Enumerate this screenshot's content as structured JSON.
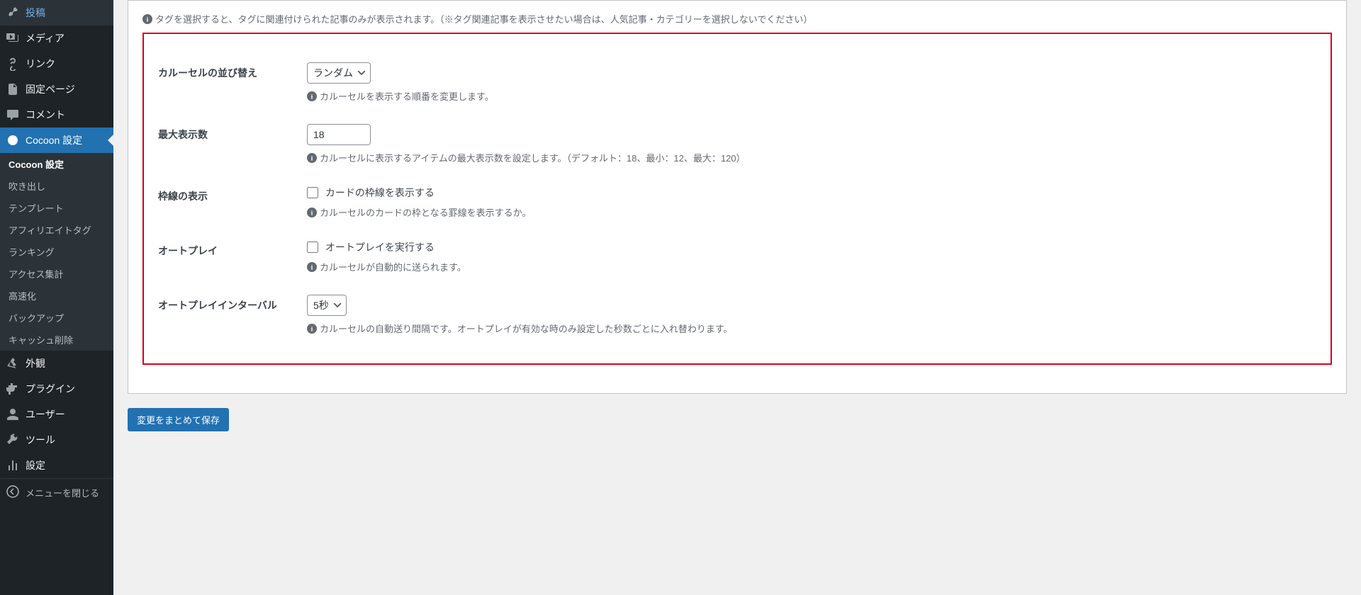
{
  "sidebar": {
    "items": [
      {
        "label": "投稿",
        "icon": "pin"
      },
      {
        "label": "メディア",
        "icon": "media"
      },
      {
        "label": "リンク",
        "icon": "link"
      },
      {
        "label": "固定ページ",
        "icon": "page"
      },
      {
        "label": "コメント",
        "icon": "comment"
      },
      {
        "label": "Cocoon 設定",
        "icon": "cocoon"
      },
      {
        "label": "外観",
        "icon": "appearance"
      },
      {
        "label": "プラグイン",
        "icon": "plugin"
      },
      {
        "label": "ユーザー",
        "icon": "user"
      },
      {
        "label": "ツール",
        "icon": "tools"
      },
      {
        "label": "設定",
        "icon": "settings"
      }
    ],
    "submenu": [
      "Cocoon 設定",
      "吹き出し",
      "テンプレート",
      "アフィリエイトタグ",
      "ランキング",
      "アクセス集計",
      "高速化",
      "バックアップ",
      "キャッシュ削除"
    ],
    "collapse": "メニューを閉じる"
  },
  "top_hint": "タグを選択すると、タグに関連付けられた記事のみが表示されます。（※タグ関連記事を表示させたい場合は、人気記事・カテゴリーを選択しないでください）",
  "fields": {
    "sort": {
      "label": "カルーセルの並び替え",
      "value": "ランダム",
      "hint": "カルーセルを表示する順番を変更します。"
    },
    "max": {
      "label": "最大表示数",
      "value": "18",
      "hint": "カルーセルに表示するアイテムの最大表示数を設定します。（デフォルト：18、最小：12、最大：120）"
    },
    "border": {
      "label": "枠線の表示",
      "checkbox": "カードの枠線を表示する",
      "hint": "カルーセルのカードの枠となる罫線を表示するか。"
    },
    "autoplay": {
      "label": "オートプレイ",
      "checkbox": "オートプレイを実行する",
      "hint": "カルーセルが自動的に送られます。"
    },
    "interval": {
      "label": "オートプレイインターバル",
      "value": "5秒",
      "hint": "カルーセルの自動送り間隔です。オートプレイが有効な時のみ設定した秒数ごとに入れ替わります。"
    }
  },
  "save_button": "変更をまとめて保存"
}
